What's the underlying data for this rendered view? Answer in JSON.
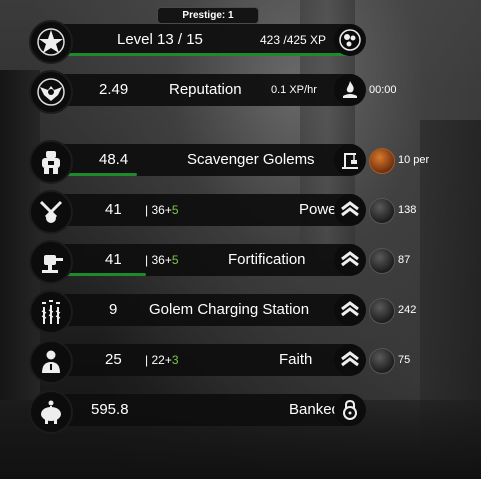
{
  "prestige": "Prestige: 1",
  "level": {
    "title": "Level 13 / 15",
    "xp": "423 /425 XP",
    "progress": 0.995
  },
  "reputation": {
    "value": "2.49",
    "label": "Reputation",
    "rate": "0.1 XP/hr",
    "timer": "00:00"
  },
  "golems": {
    "value": "48.4",
    "label": "Scavenger Golems",
    "cost": "10 per",
    "progress": 0.3
  },
  "power": {
    "value": "41",
    "base": "36",
    "bonus": "5",
    "label": "Power",
    "cost": "138"
  },
  "fortification": {
    "value": "41",
    "base": "36",
    "bonus": "5",
    "label": "Fortification",
    "cost": "87",
    "progress": 0.33
  },
  "charging": {
    "value": "9",
    "label": "Golem Charging Station",
    "cost": "242"
  },
  "faith": {
    "value": "25",
    "base": "22",
    "bonus": "3",
    "label": "Faith",
    "cost": "75"
  },
  "banked": {
    "value": "595.8",
    "label": "Banked"
  },
  "separator": "|",
  "plus": "+",
  "icons": {
    "level": "star-icon",
    "reputation": "winged-emblem-icon",
    "golems": "golem-icon",
    "power": "crossed-swords-icon",
    "fortification": "turret-icon",
    "charging": "lightning-rods-icon",
    "faith": "praying-figure-icon",
    "banked": "piggy-bank-icon"
  },
  "colors": {
    "progress": "#1e8a2c",
    "bonus": "#7ac943"
  }
}
